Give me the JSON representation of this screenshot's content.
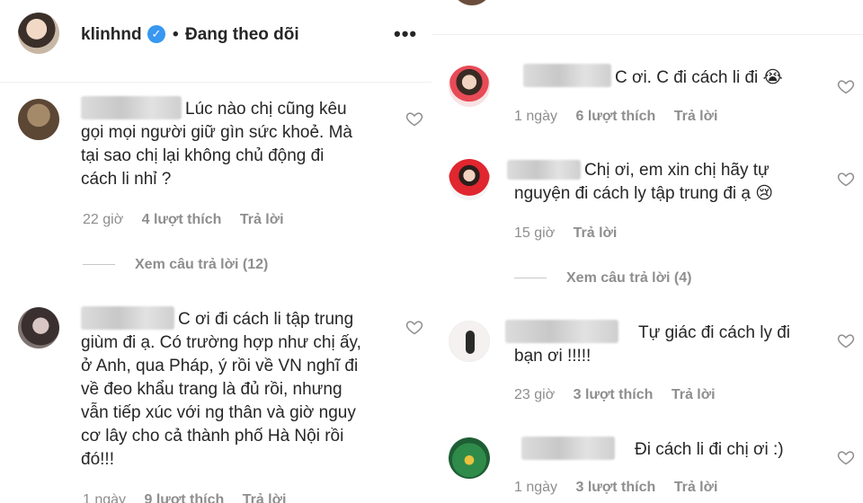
{
  "post": {
    "username": "klinhnd",
    "separator": "•",
    "follow_status": "Đang theo dõi",
    "more_label": "•••"
  },
  "icons": {
    "verified": "verified-badge-icon",
    "like": "heart-outline-icon",
    "more": "more-options-icon"
  },
  "colors": {
    "meta": "#8e8e8e",
    "verified": "#3897f0",
    "text": "#262626"
  },
  "left_comments": [
    {
      "text": "Lúc nào chị cũng kêu\ngọi mọi người giữ gìn sức khoẻ. Mà\ntại sao chị lại không chủ động đi\ncách li nhỉ ?",
      "time": "22 giờ",
      "likes": "4 lượt thích",
      "reply": "Trả lời",
      "view_replies": "Xem câu trả lời (12)"
    },
    {
      "text": "C ơi đi cách li tập trung\ngiùm đi ạ. Có trường hợp như chị ấy,\nở Anh, qua Pháp, ý rồi về VN nghĩ đi\nvề đeo khẩu trang là đủ rồi, nhưng\nvẫn tiếp xúc với ng thân và giờ nguy\ncơ lây cho cả thành phố Hà Nội rồi\nđó!!!",
      "time": "1 ngày",
      "likes": "9 lượt thích",
      "reply": "Trả lời"
    }
  ],
  "right_comments": [
    {
      "text": "C ơi. C đi cách li đi 😭",
      "time": "1 ngày",
      "likes": "6 lượt thích",
      "reply": "Trả lời"
    },
    {
      "text": "Chị ơi, em xin chị hãy tự\nnguyện đi cách ly tập trung đi ạ 😢",
      "time": "15 giờ",
      "reply": "Trả lời",
      "view_replies": "Xem câu trả lời (4)"
    },
    {
      "text": "Tự giác đi cách ly đi\nbạn ơi !!!!!",
      "time": "23 giờ",
      "likes": "3 lượt thích",
      "reply": "Trả lời"
    },
    {
      "text": "Đi cách li đi chị ơi :)",
      "time": "1 ngày",
      "likes": "3 lượt thích",
      "reply": "Trả lời"
    }
  ]
}
